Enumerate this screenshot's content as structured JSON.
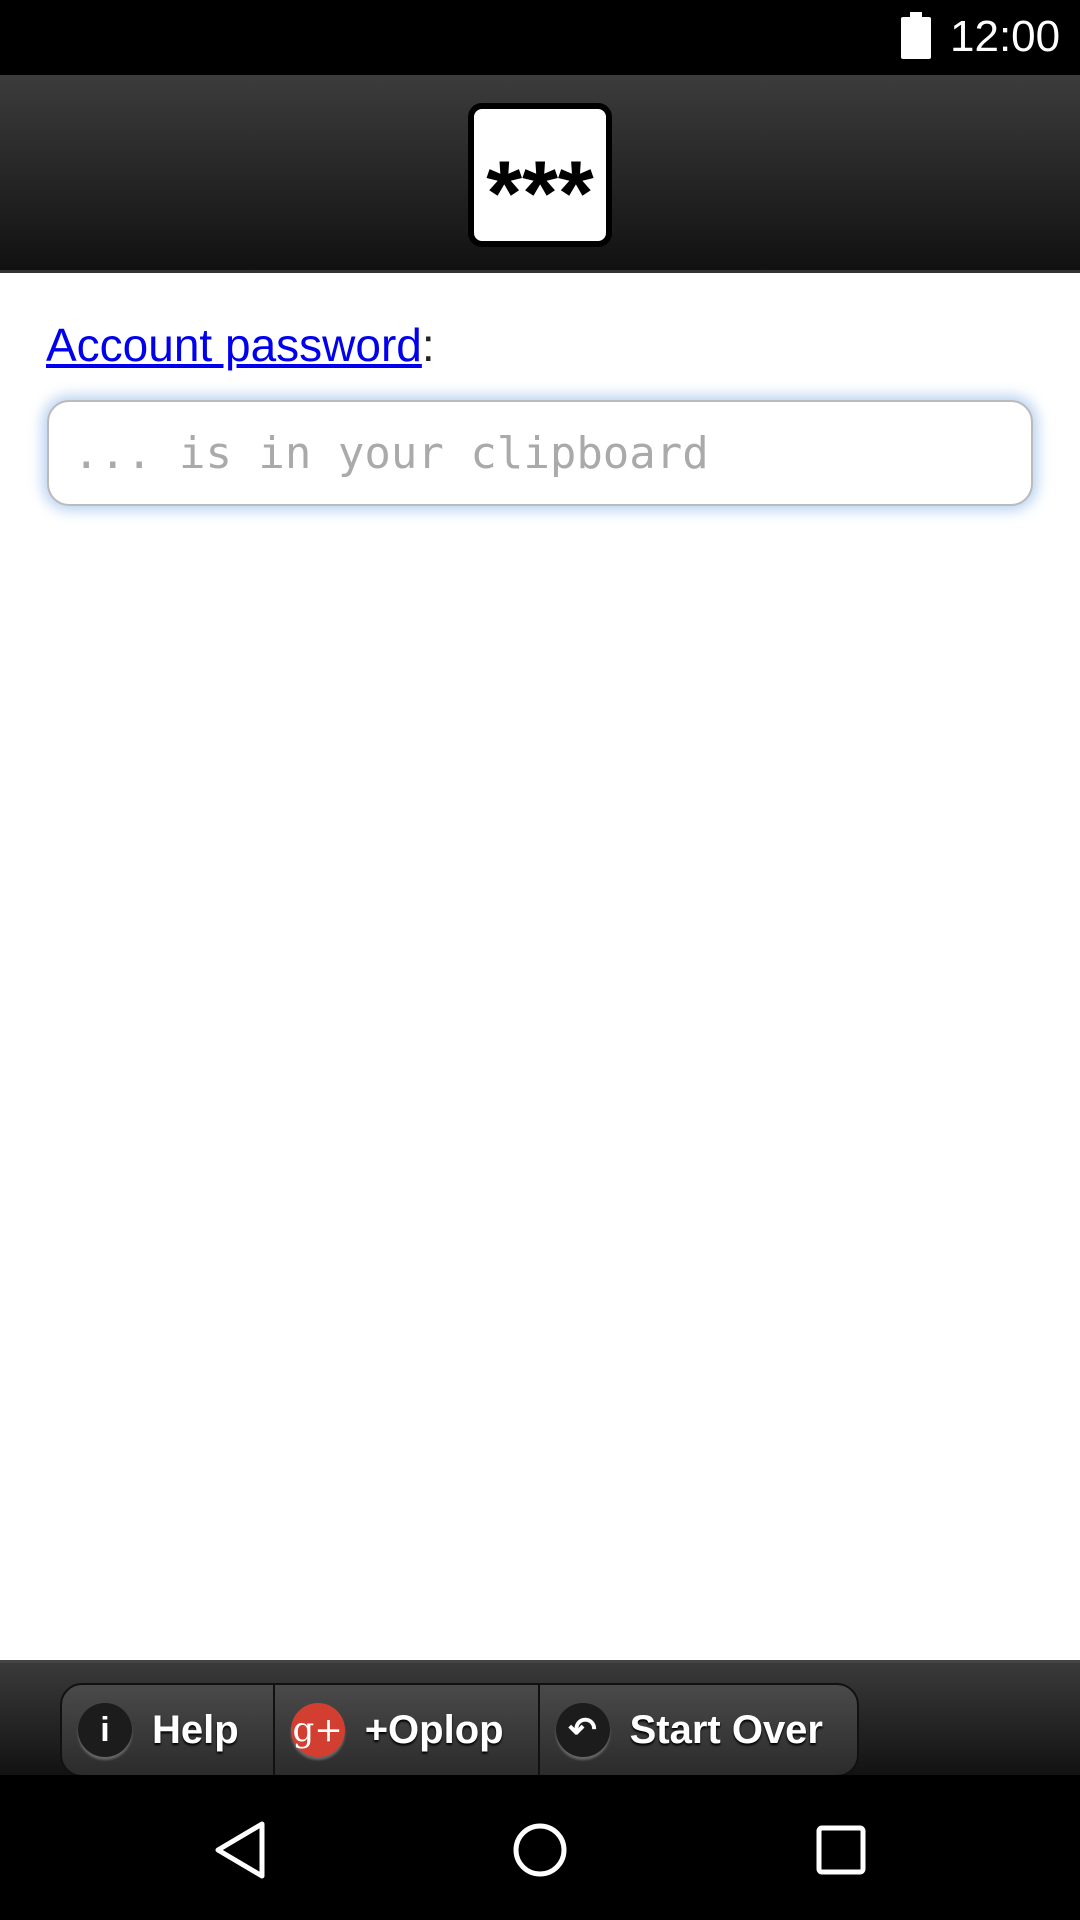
{
  "status_bar": {
    "time": "12:00",
    "battery_icon": "battery-full-icon"
  },
  "header": {
    "logo_text": "***"
  },
  "form": {
    "label_link": "Account password",
    "label_suffix": ":",
    "password_placeholder": "... is in your clipboard"
  },
  "footer": {
    "buttons": [
      {
        "label": "Help",
        "icon": "i"
      },
      {
        "label": "+Oplop",
        "icon": "g+"
      },
      {
        "label": "Start Over",
        "icon": "↶"
      }
    ]
  },
  "nav": {
    "back": "back-icon",
    "home": "home-icon",
    "recents": "recents-icon"
  }
}
